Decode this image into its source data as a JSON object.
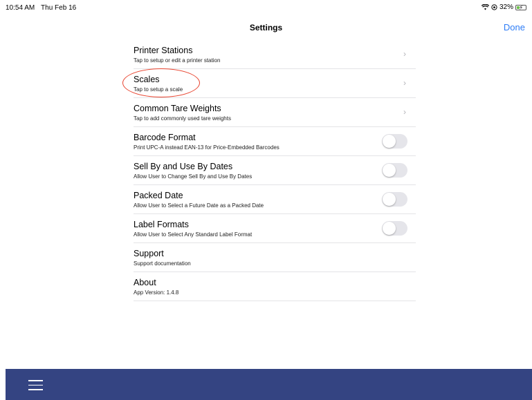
{
  "status_bar": {
    "time": "10:54 AM",
    "date": "Thu Feb 16",
    "battery": "32%",
    "battery_level": 0.32
  },
  "nav": {
    "title": "Settings",
    "done_label": "Done"
  },
  "colors": {
    "accent": "#2d7cf6",
    "bottom_bar": "#344482",
    "annotation": "#e8432e"
  },
  "settings": [
    {
      "title": "Printer Stations",
      "subtitle": "Tap to setup or edit a printer station",
      "control": "chevron"
    },
    {
      "title": "Scales",
      "subtitle": "Tap to setup a scale",
      "control": "chevron"
    },
    {
      "title": "Common Tare Weights",
      "subtitle": "Tap to add commonly used tare weights",
      "control": "chevron"
    },
    {
      "title": "Barcode Format",
      "subtitle": "Print UPC-A instead EAN-13 for Price-Embedded Barcodes",
      "control": "toggle",
      "on": false
    },
    {
      "title": "Sell By and Use By Dates",
      "subtitle": "Allow User to Change Sell By and Use By Dates",
      "control": "toggle",
      "on": false
    },
    {
      "title": "Packed Date",
      "subtitle": "Allow User to Select a Future Date as a Packed Date",
      "control": "toggle",
      "on": false
    },
    {
      "title": "Label Formats",
      "subtitle": "Allow User to Select Any Standard Label Format",
      "control": "toggle",
      "on": false
    },
    {
      "title": "Support",
      "subtitle": "Support documentation",
      "control": "none"
    },
    {
      "title": "About",
      "subtitle": "App Version: 1.4.8",
      "control": "none"
    }
  ],
  "icons": {
    "chevron": "chevron-right-icon",
    "menu": "hamburger-menu-icon",
    "wifi": "wifi-icon",
    "battery": "battery-icon"
  }
}
